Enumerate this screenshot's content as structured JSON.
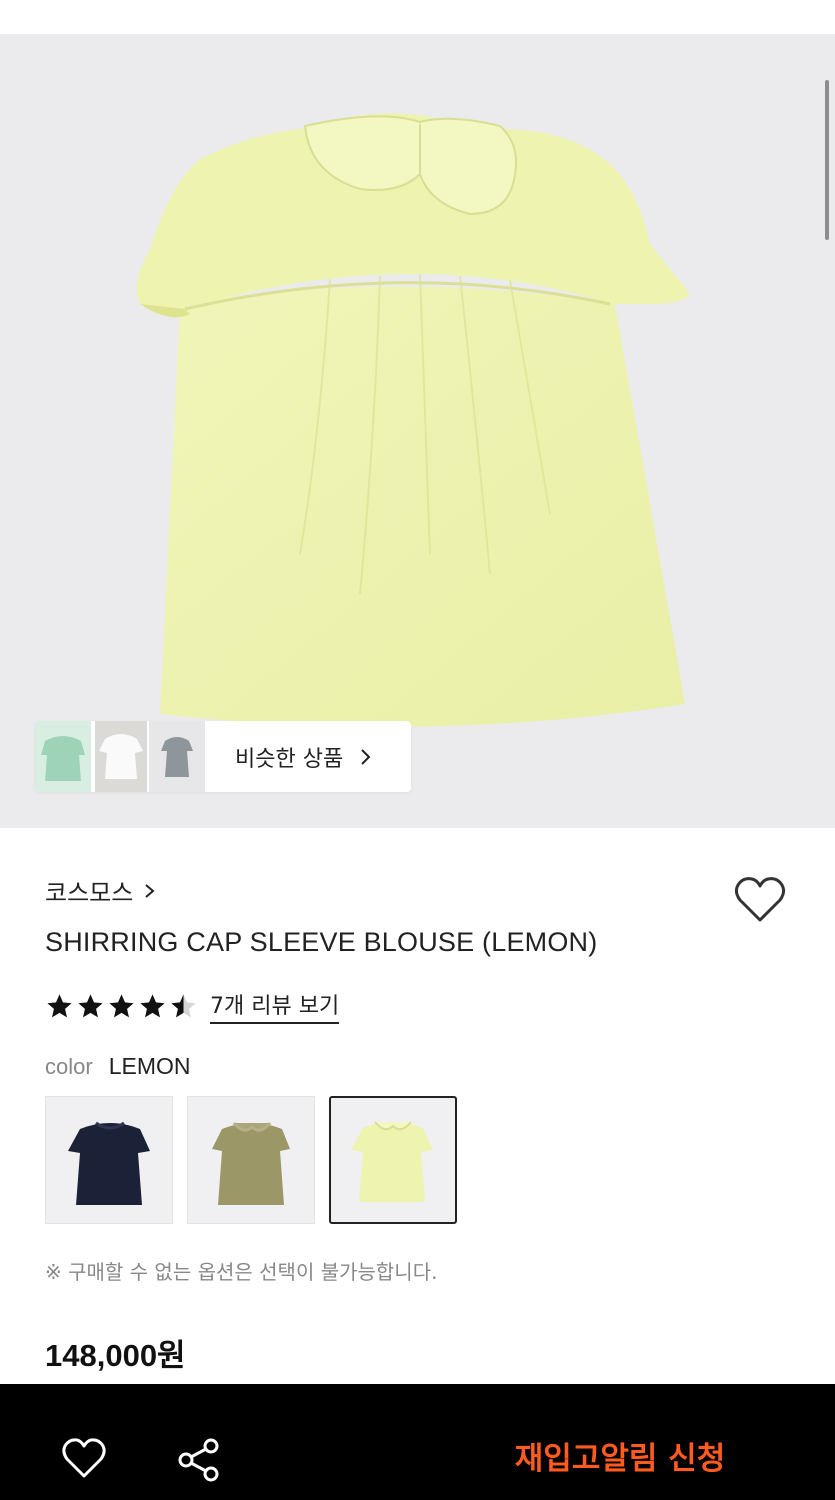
{
  "gallery": {
    "similar_products_label": "비슷한 상품",
    "similar_thumbs": [
      "mint-blouse",
      "white-blouse",
      "grey-blouse"
    ]
  },
  "product": {
    "brand": "코스모스",
    "title": "SHIRRING CAP SLEEVE BLOUSE (LEMON)",
    "rating": 4.5,
    "rating_max": 5,
    "review_link": "7개 리뷰 보기",
    "color_label": "color",
    "color_value": "LEMON",
    "swatches": [
      {
        "name": "navy",
        "color": "#1b2238",
        "selected": false
      },
      {
        "name": "olive",
        "color": "#9c9767",
        "selected": false
      },
      {
        "name": "lemon",
        "color": "#eef3b0",
        "selected": true
      }
    ],
    "option_note": "※ 구매할 수 없는 옵션은 선택이 불가능합니다.",
    "price": "148,000원"
  },
  "bottom_bar": {
    "wishlist_icon": "heart-icon",
    "share_icon": "share-icon",
    "restock_label": "재입고알림 신청",
    "restock_color": "#ff5b1f"
  },
  "colors": {
    "blouse": "#eef3b0",
    "hero_bg": "#ebebed"
  }
}
